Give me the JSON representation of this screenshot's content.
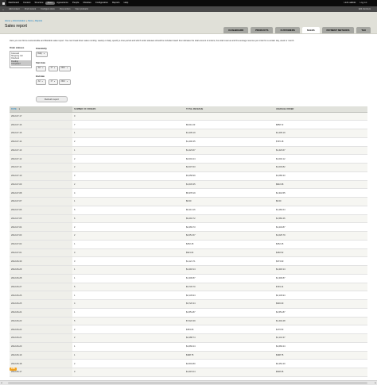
{
  "toolbar": {
    "items": [
      "Dashboard",
      "Content",
      "Structure",
      "Store",
      "Appearance",
      "People",
      "Modules",
      "Configuration",
      "Reports",
      "Help"
    ],
    "active_index": 3,
    "user_greeting": "Hello ",
    "username": "admin",
    "logout": "Log out"
  },
  "shortcuts": {
    "add_icon": "+",
    "items": [
      "Add content",
      "Find content",
      "Configure store",
      "View orders",
      "View products"
    ],
    "edit": "Edit shortcuts"
  },
  "breadcrumb": [
    "Home",
    "Administration",
    "Store",
    "Reports"
  ],
  "breadcrumb_separator": " » ",
  "page_title": "Sales report",
  "tabs": [
    "DASHBOARD",
    "PRODUCTS",
    "CUSTOMERS",
    "SALES",
    "PAYMENT METHODS",
    "TAX"
  ],
  "active_tab": "SALES",
  "help_text": "Here you can find a customizable and filterable sales report. You can break down sales monthly, weekly or daily, specify a time period and which order statuses should be included. Each line indicates the total amount of orders, the total revenue and the average revenue per order for a certain day, week or month.",
  "form": {
    "order_statuses_label": "Order statuses",
    "order_statuses": [
      {
        "label": "Canceled",
        "selected": false
      },
      {
        "label": "Shopping cart",
        "selected": false
      },
      {
        "label": "Checkout",
        "selected": false
      },
      {
        "label": "Pending",
        "selected": true
      },
      {
        "label": "Completed",
        "selected": true
      }
    ],
    "granularity_label": "Granularity",
    "granularity_value": "Daily",
    "start_date_label": "Start date",
    "start_month": "Jun",
    "start_day": "17",
    "start_year": "2012",
    "end_date_label": "End date",
    "end_month": "Jul",
    "end_day": "17",
    "end_year": "2012",
    "refresh_button": "Refresh report"
  },
  "table": {
    "columns": [
      "DATE",
      "NUMBER OF ORDERS",
      "TOTAL REVENUE",
      "AVERAGE ORDER"
    ],
    "sort_column": 0,
    "rows": [
      [
        "2012-07-17",
        "0",
        "",
        ""
      ],
      [
        "2012-07-16",
        "7",
        "$6,011.03",
        "$858.72"
      ],
      [
        "2012-07-15",
        "1",
        "$1,205.19",
        "$1,205.19"
      ],
      [
        "2012-07-14",
        "2",
        "$1,490.35",
        "$745.18"
      ],
      [
        "2012-07-13",
        "1",
        "$1,423.67",
        "$1,423.67"
      ],
      [
        "2012-07-12",
        "2",
        "$2,004.24",
        "$1,002.12"
      ],
      [
        "2012-07-11",
        "2",
        "$2,007.63",
        "$1,003.82"
      ],
      [
        "2012-07-10",
        "3",
        "$3,258.99",
        "$1,086.33"
      ],
      [
        "2012-07-09",
        "2",
        "$1,645.35",
        "$822.68"
      ],
      [
        "2012-07-08",
        "4",
        "$5,378.19",
        "$1,344.55"
      ],
      [
        "2012-07-07",
        "1",
        "$0.00",
        "$0.00"
      ],
      [
        "2012-07-06",
        "5",
        "$6,413.16",
        "$1,282.64"
      ],
      [
        "2012-07-05",
        "6",
        "$9,494.72",
        "$1,582.46"
      ],
      [
        "2012-07-04",
        "2",
        "$2,469.73",
        "$1,234.87"
      ],
      [
        "2012-07-03",
        "2",
        "$2,051.57",
        "$1,025.79"
      ],
      [
        "2012-07-02",
        "1",
        "$252.45",
        "$252.45"
      ],
      [
        "2012-07-01",
        "3",
        "$921.04",
        "$460.52"
      ],
      [
        "2012-06-30",
        "3",
        "$1,121.71",
        "$373.90"
      ],
      [
        "2012-06-29",
        "1",
        "$1,218.14",
        "$1,218.14"
      ],
      [
        "2012-06-28",
        "1",
        "$1,306.87",
        "$1,306.87"
      ],
      [
        "2012-06-27",
        "5",
        "$3,745.70",
        "$749.14"
      ],
      [
        "2012-06-26",
        "1",
        "$2,139.94",
        "$2,139.94"
      ],
      [
        "2012-06-25",
        "4",
        "$3,720.34",
        "$930.09"
      ],
      [
        "2012-06-24",
        "1",
        "$1,551.87",
        "$1,551.87"
      ],
      [
        "2012-06-23",
        "5",
        "$7,022.39",
        "$1,404.48"
      ],
      [
        "2012-06-22",
        "2",
        "$353.06",
        "$176.53"
      ],
      [
        "2012-06-21",
        "2",
        "$2,288.74",
        "$1,144.37"
      ],
      [
        "2012-06-20",
        "1",
        "$1,666.24",
        "$1,666.24"
      ],
      [
        "2012-06-19",
        "1",
        "$398.75",
        "$398.75"
      ],
      [
        "2012-06-18",
        "2",
        "$4,504.80",
        "$2,252.40"
      ],
      [
        "2012-06-17",
        "3",
        "$1,615.04",
        "$538.35"
      ]
    ]
  },
  "export_label": "CSV",
  "scrollbar": {
    "left_arrow": "◂",
    "right_arrow": "▸"
  }
}
